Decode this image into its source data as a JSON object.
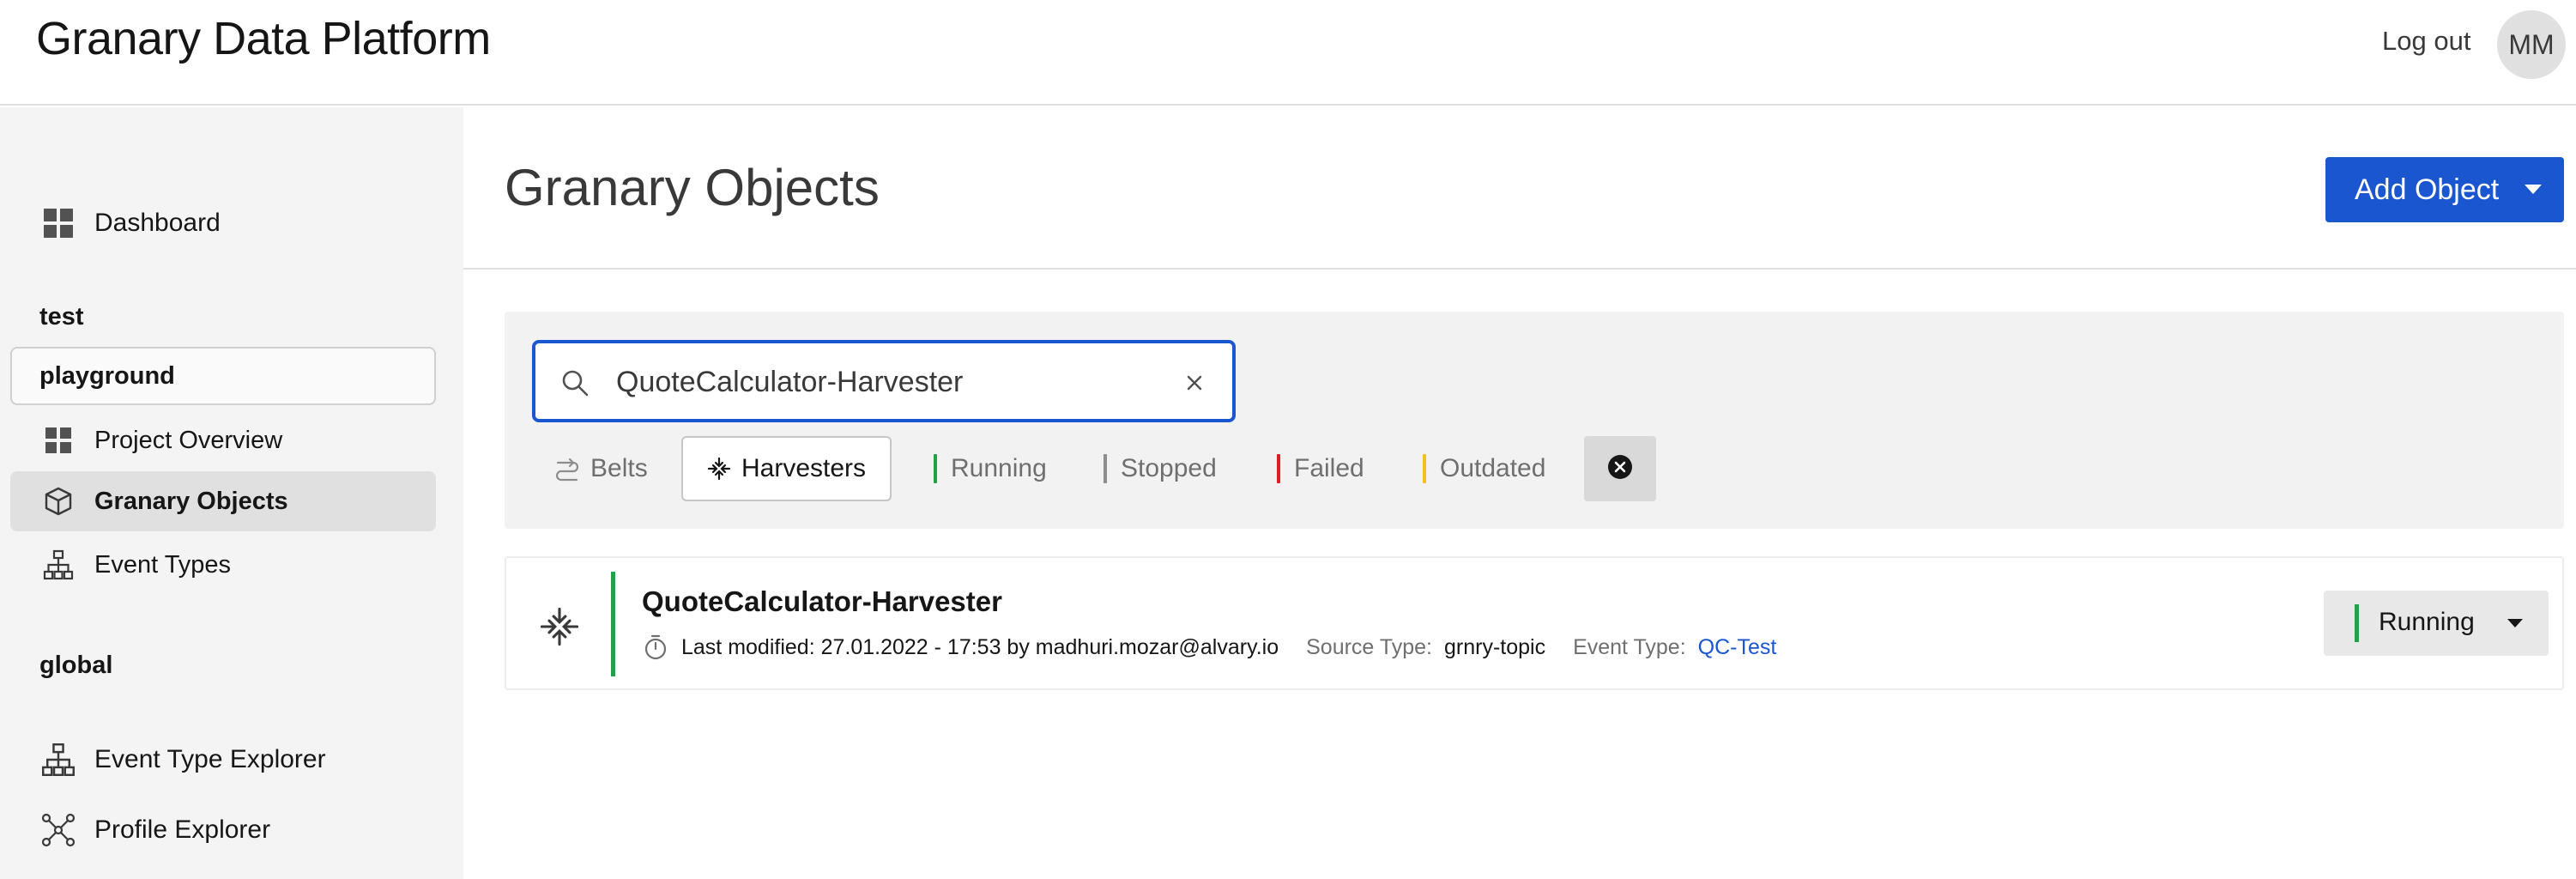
{
  "header": {
    "app_title": "Granary Data Platform",
    "logout_label": "Log out",
    "avatar_initials": "MM"
  },
  "sidebar": {
    "dashboard_label": "Dashboard",
    "section_test": "test",
    "project_name": "playground",
    "project_items": [
      {
        "label": "Project Overview",
        "icon": "grid-icon"
      },
      {
        "label": "Granary Objects",
        "icon": "cube-icon",
        "active": true
      },
      {
        "label": "Event Types",
        "icon": "hierarchy-icon"
      }
    ],
    "section_global": "global",
    "global_items": [
      {
        "label": "Event Type Explorer",
        "icon": "hierarchy-icon"
      },
      {
        "label": "Profile Explorer",
        "icon": "network-icon"
      }
    ]
  },
  "main": {
    "page_title": "Granary Objects",
    "add_button_label": "Add Object",
    "search": {
      "value": "QuoteCalculator-Harvester",
      "placeholder": ""
    },
    "type_filters": [
      {
        "label": "Belts",
        "icon": "belts-icon",
        "selected": false
      },
      {
        "label": "Harvesters",
        "icon": "harvester-icon",
        "selected": true
      }
    ],
    "status_filters": [
      {
        "label": "Running",
        "color": "#24a148"
      },
      {
        "label": "Stopped",
        "color": "#8d8d8d"
      },
      {
        "label": "Failed",
        "color": "#da1e28"
      },
      {
        "label": "Outdated",
        "color": "#f1c21b"
      }
    ],
    "results": [
      {
        "name": "QuoteCalculator-Harvester",
        "icon": "harvester-icon",
        "modified": "Last modified: 27.01.2022 - 17:53 by madhuri.mozar@alvary.io",
        "source_type_label": "Source Type:",
        "source_type": "grnry-topic",
        "event_type_label": "Event Type:",
        "event_type": "QC-Test",
        "status": "Running",
        "status_color": "#24a148"
      }
    ]
  },
  "colors": {
    "accent": "#1a56d0",
    "running": "#24a148"
  }
}
